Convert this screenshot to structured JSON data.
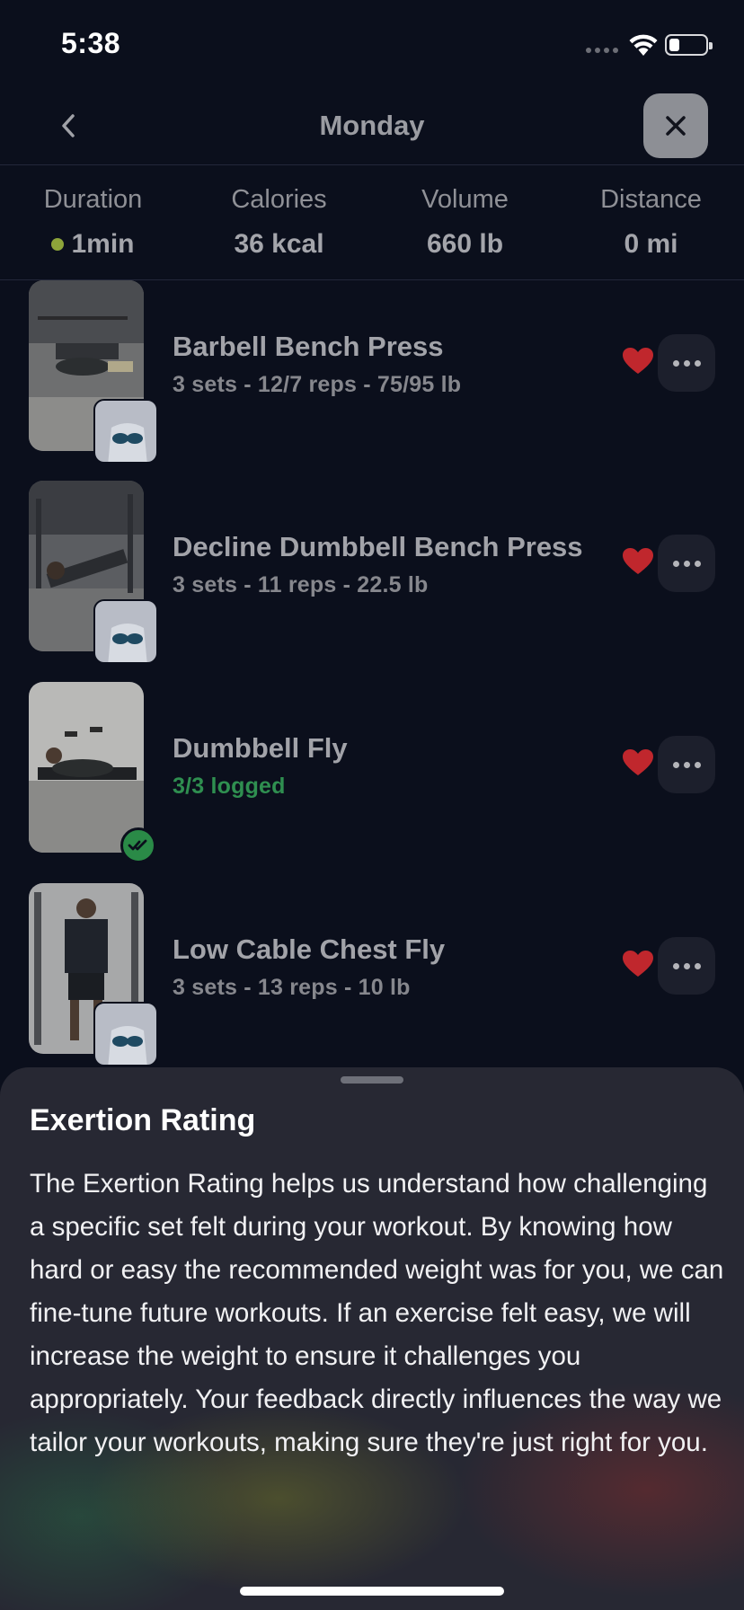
{
  "status_bar": {
    "time": "5:38"
  },
  "header": {
    "title": "Monday",
    "back_icon": "chevron-left-icon",
    "close_icon": "close-icon"
  },
  "stats": [
    {
      "label": "Duration",
      "value": "1min",
      "indicator_color": "#8da43a"
    },
    {
      "label": "Calories",
      "value": "36 kcal"
    },
    {
      "label": "Volume",
      "value": "660 lb"
    },
    {
      "label": "Distance",
      "value": "0 mi"
    }
  ],
  "exercises": [
    {
      "name": "Barbell Bench Press",
      "detail": "3 sets - 12/7 reps - 75/95 lb",
      "status": "pending",
      "favorite": true
    },
    {
      "name": "Decline Dumbbell Bench Press",
      "detail": "3 sets - 11 reps - 22.5 lb",
      "status": "pending",
      "favorite": true
    },
    {
      "name": "Dumbbell Fly",
      "detail": "3/3 logged",
      "status": "logged",
      "favorite": true
    },
    {
      "name": "Low Cable Chest Fly",
      "detail": "3 sets - 13 reps - 10 lb",
      "status": "pending",
      "favorite": true
    }
  ],
  "sheet": {
    "title": "Exertion Rating",
    "body": "The Exertion Rating helps us understand how challenging a specific set felt during your workout. By knowing how hard or easy the recommended weight was for you, we can fine-tune future workouts. If an exercise felt easy, we will increase the weight to ensure it challenges you appropriately. Your feedback directly influences the way we tailor your workouts, making sure they're just right for you."
  },
  "colors": {
    "background": "#0b0f1c",
    "heart": "#c0272d",
    "logged": "#2f8f50",
    "sheet": "#272833"
  }
}
